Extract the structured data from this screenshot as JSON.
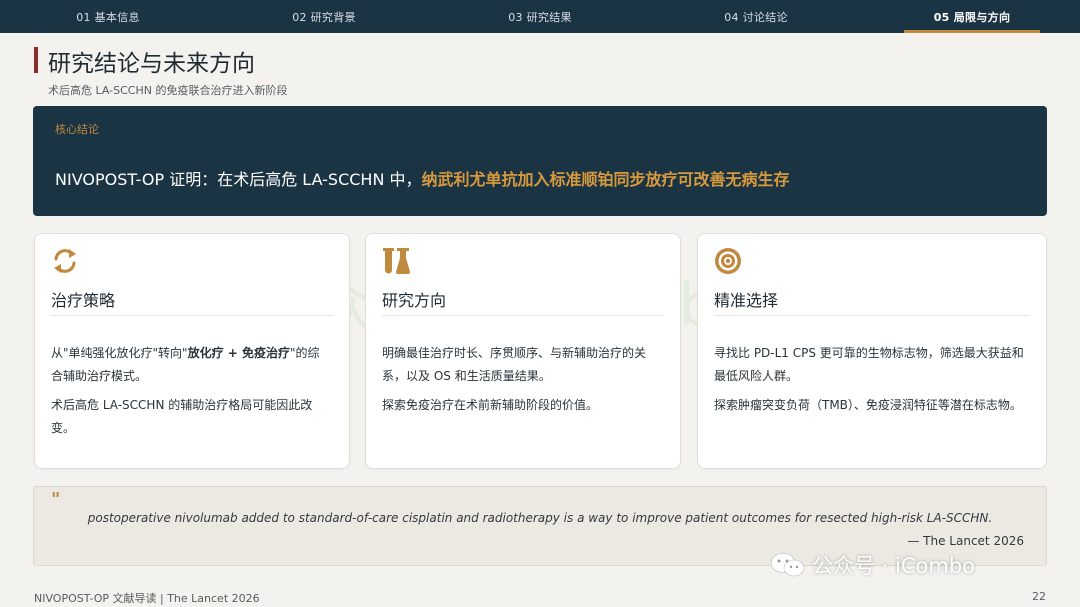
{
  "nav": {
    "tabs": [
      {
        "label": "01 基本信息"
      },
      {
        "label": "02 研究背景"
      },
      {
        "label": "03 研究结果"
      },
      {
        "label": "04 讨论结论"
      },
      {
        "label": "05 局限与方向"
      }
    ],
    "active_index": 4
  },
  "page": {
    "title": "研究结论与未来方向",
    "subtitle": "术后高危 LA-SCCHN 的免疫联合治疗进入新阶段"
  },
  "core": {
    "label": "核心结论",
    "text_plain": "NIVOPOST-OP 证明：在术后高危 LA-SCCHN 中，",
    "text_highlight": "纳武利尤单抗加入标准顺铂同步放疗可改善无病生存"
  },
  "cards": [
    {
      "icon": "refresh-icon",
      "title": "治疗策略",
      "p1_a": "从\"单纯强化放化疗\"转向\"",
      "p1_b": "放化疗 + 免疫治疗",
      "p1_c": "\"的综合辅助治疗模式。",
      "p2": "术后高危 LA-SCCHN 的辅助治疗格局可能因此改变。"
    },
    {
      "icon": "lab-flasks-icon",
      "title": "研究方向",
      "p1": "明确最佳治疗时长、序贯顺序、与新辅助治疗的关系，以及 OS 和生活质量结果。",
      "p2": "探索免疫治疗在术前新辅助阶段的价值。"
    },
    {
      "icon": "target-icon",
      "title": "精准选择",
      "p1": "寻找比 PD-L1 CPS 更可靠的生物标志物，筛选最大获益和最低风险人群。",
      "p2": "探索肿瘤突变负荷（TMB）、免疫浸润特征等潜在标志物。"
    }
  ],
  "quote": {
    "mark": "\"",
    "text": "postoperative nivolumab added to standard-of-care cisplatin and radiotherapy is a way to improve patient outcomes for resected high-risk LA-SCCHN.",
    "source": "— The Lancet 2026"
  },
  "footer": {
    "left": "NIVOPOST-OP 文献导读 | The Lancet 2026",
    "page_number": "22"
  },
  "watermark": {
    "center": "公众号：iCombo",
    "corner": "公众号 · iCombo"
  },
  "colors": {
    "navy": "#1b3444",
    "gold": "#c08a3e",
    "highlight": "#d99a3e",
    "title_accent": "#8b2b2b",
    "background": "#f4f2ee"
  }
}
